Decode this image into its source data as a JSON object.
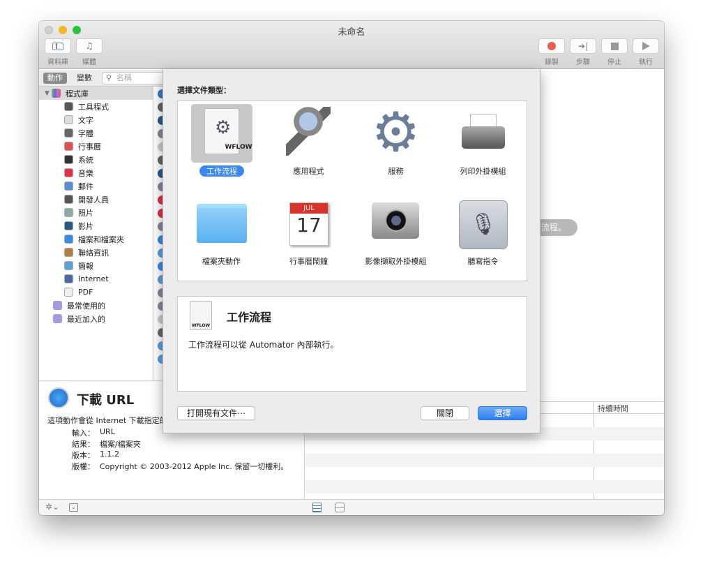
{
  "window": {
    "title": "未命名"
  },
  "toolbar": {
    "left": [
      {
        "label": "資料庫",
        "icon": "sidebar-icon"
      },
      {
        "label": "媒體",
        "icon": "media-icon"
      }
    ],
    "right": [
      {
        "label": "錄製",
        "icon": "record-icon"
      },
      {
        "label": "步驟",
        "icon": "step-icon"
      },
      {
        "label": "停止",
        "icon": "stop-icon"
      },
      {
        "label": "執行",
        "icon": "play-icon"
      }
    ]
  },
  "library": {
    "tab_actions": "動作",
    "tab_variables": "變數",
    "search_placeholder": "名稱",
    "root": "程式庫",
    "items": [
      {
        "label": "工具程式",
        "color": "#555"
      },
      {
        "label": "文字",
        "color": "#ddd"
      },
      {
        "label": "字體",
        "color": "#666"
      },
      {
        "label": "行事曆",
        "color": "#e05050"
      },
      {
        "label": "系統",
        "color": "#333"
      },
      {
        "label": "音樂",
        "color": "#e0304a"
      },
      {
        "label": "郵件",
        "color": "#5b8fd0"
      },
      {
        "label": "開發人員",
        "color": "#555"
      },
      {
        "label": "照片",
        "color": "#8aa"
      },
      {
        "label": "影片",
        "color": "#2a5a8a"
      },
      {
        "label": "檔案和檔案夾",
        "color": "#3a8ae0"
      },
      {
        "label": "聯絡資訊",
        "color": "#b08040"
      },
      {
        "label": "簡報",
        "color": "#5aa0d8"
      },
      {
        "label": "Internet",
        "color": "#4a6aa0"
      },
      {
        "label": "PDF",
        "color": "#eee"
      }
    ],
    "smart": [
      {
        "label": "最常使用的"
      },
      {
        "label": "最近加入的"
      }
    ]
  },
  "description": {
    "title": "下載 URL",
    "text": "這項動作會從 Internet 下載指定的",
    "rows": [
      {
        "k": "輸入：",
        "v": "URL"
      },
      {
        "k": "結果：",
        "v": "檔案/檔案夾"
      },
      {
        "k": "版本：",
        "v": "1.1.2"
      },
      {
        "k": "版權：",
        "v": "Copyright © 2003-2012 Apple Inc. 保留一切權利。"
      }
    ]
  },
  "workflow": {
    "hint": "作流程。"
  },
  "log": {
    "col_duration": "持續時間"
  },
  "sheet": {
    "prompt": "選擇文件類型：",
    "types": [
      {
        "label": "工作流程",
        "selected": true
      },
      {
        "label": "應用程式"
      },
      {
        "label": "服務"
      },
      {
        "label": "列印外掛模組"
      },
      {
        "label": "檔案夾動作"
      },
      {
        "label": "行事曆鬧鐘"
      },
      {
        "label": "影像擷取外掛模組"
      },
      {
        "label": "聽寫指令"
      }
    ],
    "wflow_badge": "WFLOW",
    "cal_month": "JUL",
    "cal_day": "17",
    "detail_title": "工作流程",
    "detail_text": "工作流程可以從 Automator 內部執行。",
    "open_existing": "打開現有文件⋯",
    "close": "關閉",
    "choose": "選擇"
  },
  "colors": {
    "accent": "#3b88f5",
    "record": "#e8604c"
  }
}
